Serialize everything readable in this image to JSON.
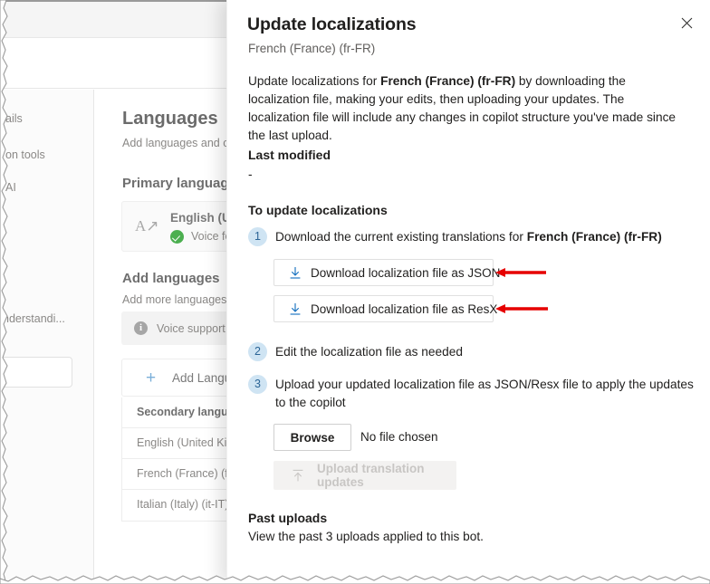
{
  "background": {
    "nav_items": [
      {
        "label": "ails"
      },
      {
        "label": "on tools"
      },
      {
        "label": "AI"
      },
      {
        "label": "nderstandi..."
      }
    ],
    "heading": "Languages",
    "subheading": "Add languages and c",
    "primary_language_heading": "Primary language",
    "primary_card": {
      "title": "English (Unit",
      "status": "Voice feat",
      "icon": "translate-icon"
    },
    "add_languages_heading": "Add languages",
    "add_languages_sub": "Add more languages",
    "info_banner": "Voice support is",
    "add_language_button": "Add Languag",
    "table": {
      "header": "Secondary languag",
      "rows": [
        "English (United Kin",
        "French (France) (fr-",
        "Italian (Italy) (it-IT)"
      ]
    }
  },
  "panel": {
    "title": "Update localizations",
    "subtitle": "French (France) (fr-FR)",
    "close_label": "✕",
    "intro": {
      "part1": "Update localizations for ",
      "bold": "French (France) (fr-FR)",
      "part2": " by downloading the localization file, making your edits, then uploading your updates. The localization file will include any changes in copilot structure you've made since the last upload."
    },
    "last_modified_label": "Last modified",
    "last_modified_value": "-",
    "to_update_label": "To update localizations",
    "steps": [
      {
        "number": "1",
        "text_part1": "Download the current existing translations for ",
        "text_bold": "French (France) (fr-FR)"
      },
      {
        "number": "2",
        "text_part1": "Edit the localization file as needed",
        "text_bold": ""
      },
      {
        "number": "3",
        "text_part1": "Upload your updated localization file as JSON/Resx file to apply the updates to the copilot",
        "text_bold": ""
      }
    ],
    "download_json_label": "Download localization file as JSON",
    "download_resx_label": "Download localization file as ResX",
    "browse_label": "Browse",
    "no_file_label": "No file chosen",
    "upload_label": "Upload translation updates",
    "past_uploads_title": "Past uploads",
    "past_uploads_sub": "View the past 3 uploads applied to this bot."
  },
  "colors": {
    "accent_blue": "#0f6cbd",
    "step_circle_bg": "#cfe4f3",
    "step_circle_fg": "#2a6496",
    "annotation_red": "#e60000",
    "text_primary": "#201f1e",
    "text_secondary": "#605e5c"
  },
  "annotations": [
    {
      "name": "arrow-to-json-button",
      "direction": "left"
    },
    {
      "name": "arrow-to-resx-button",
      "direction": "left"
    }
  ]
}
